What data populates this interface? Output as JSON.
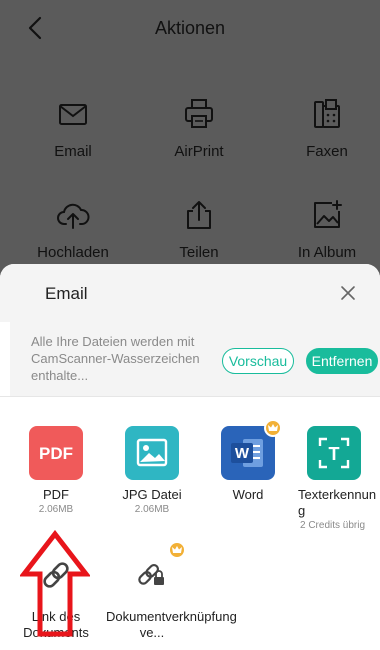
{
  "header": {
    "title": "Aktionen"
  },
  "actions": [
    {
      "label": "Email",
      "icon": "mail-icon"
    },
    {
      "label": "AirPrint",
      "icon": "printer-icon"
    },
    {
      "label": "Faxen",
      "icon": "fax-icon"
    },
    {
      "label": "Hochladen",
      "icon": "cloud-upload-icon"
    },
    {
      "label": "Teilen",
      "icon": "share-icon"
    },
    {
      "label": "In Album",
      "icon": "album-icon"
    }
  ],
  "sheet": {
    "title": "Email",
    "notice": "Alle Ihre Dateien werden mit CamScanner-Wasserzeichen enthalte...",
    "preview_label": "Vorschau",
    "remove_label": "Entfernen",
    "options": [
      {
        "name": "PDF",
        "sub": "2.06MB",
        "tile_text": "PDF",
        "color": "#f05a5a"
      },
      {
        "name": "JPG Datei",
        "sub": "2.06MB",
        "color": "#2fb6c3"
      },
      {
        "name": "Word",
        "sub": "",
        "tile_text": "W",
        "color": "#2a64b9",
        "premium": true
      },
      {
        "name": "Texterkennung",
        "sub": "2 Credits übrig",
        "tile_text": "T",
        "color": "#13a895"
      },
      {
        "name": "Link des Dokuments",
        "sub": ""
      },
      {
        "name": "Dokumentverknüpfung ve...",
        "sub": "",
        "premium": true
      }
    ]
  },
  "colors": {
    "accent": "#19bc9c",
    "overlay": "#5b5b5b",
    "arrow": "#e8151b",
    "crown": "#f2b036"
  }
}
